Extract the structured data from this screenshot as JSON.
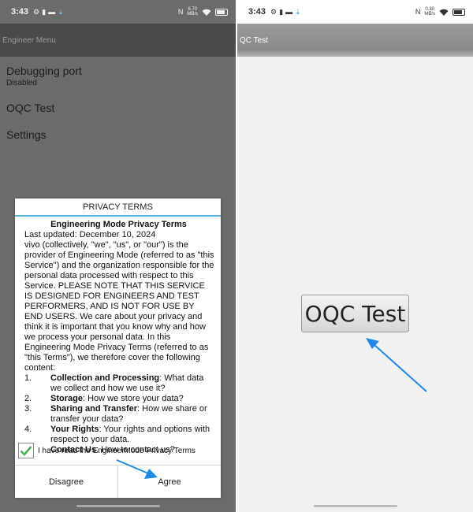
{
  "left": {
    "status": {
      "time": "3:43",
      "speed_value": "6.70",
      "speed_unit": "MB/s"
    },
    "appbar_title": "Engineer Menu",
    "menu": [
      {
        "title": "Debugging port",
        "subtitle": "Disabled"
      },
      {
        "title": "OQC Test"
      },
      {
        "title": "Settings"
      }
    ],
    "dialog": {
      "title": "PRIVACY TERMS",
      "heading": "Engineering Mode Privacy Terms",
      "updated": "Last updated: December 10, 2024",
      "paragraph": "vivo (collectively, \"we\", \"us\", or \"our\") is the provider of Engineering Mode (referred to as \"this Service\") and the organization responsible for the personal data processed with respect to this Service. PLEASE NOTE THAT THIS SERVICE IS DESIGNED FOR ENGINEERS AND TEST PERFORMERS, AND IS NOT FOR USE BY END USERS. We care about your privacy and think it is important that you know why and how we process your personal data. In this Engineering Mode Privacy Terms (referred to as \"this Terms\"), we therefore cover the following content:",
      "items": [
        {
          "num": "1.",
          "bold": "Collection and Processing",
          "text": ": What data we collect and how we use it?"
        },
        {
          "num": "2.",
          "bold": "Storage",
          "text": ": How we store your data?"
        },
        {
          "num": "3.",
          "bold": "Sharing and Transfer",
          "text": ": How we share or transfer your data?"
        },
        {
          "num": "4.",
          "bold": "Your Rights",
          "text": ": Your rights and options with respect to your data."
        },
        {
          "num": "5.",
          "bold": "Contact Us",
          "text": ": How to contact us?"
        }
      ],
      "checkbox_label": "I have read the EngineerMode Privacy Terms",
      "checkbox_checked": true,
      "disagree_label": "Disagree",
      "agree_label": "Agree"
    }
  },
  "right": {
    "status": {
      "time": "3:43",
      "speed_value": "0.30",
      "speed_unit": "MB/s"
    },
    "appbar_title": "QC Test",
    "button_label": "OQC Test"
  },
  "colors": {
    "accent_line": "#5ab4e0",
    "arrow": "#1e88e5",
    "check": "#4caf50"
  }
}
